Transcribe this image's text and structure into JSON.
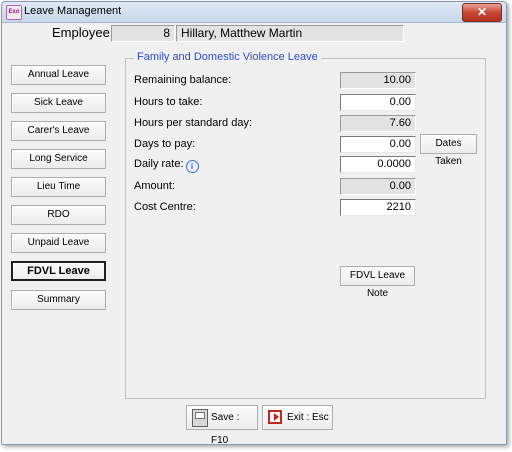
{
  "window": {
    "title": "Leave Management",
    "icon": "app-logo-icon",
    "close_label": "✕"
  },
  "employee": {
    "label": "Employee:",
    "number": "8",
    "name": "Hillary, Matthew  Martin"
  },
  "sidebar": {
    "items": [
      {
        "label": "Annual Leave",
        "active": false
      },
      {
        "label": "Sick Leave",
        "active": false
      },
      {
        "label": "Carer's Leave",
        "active": false
      },
      {
        "label": "Long Service",
        "active": false
      },
      {
        "label": "Lieu Time",
        "active": false
      },
      {
        "label": "RDO",
        "active": false
      },
      {
        "label": "Unpaid Leave",
        "active": false
      },
      {
        "label": "FDVL Leave",
        "active": true
      },
      {
        "label": "Summary",
        "active": false
      }
    ]
  },
  "group": {
    "title": "Family and Domestic Violence Leave",
    "fields": {
      "remaining_balance": {
        "label": "Remaining balance:",
        "value": "10.00",
        "editable": false
      },
      "hours_to_take": {
        "label": "Hours to take:",
        "value": "0.00",
        "editable": true
      },
      "hours_per_day": {
        "label": "Hours per standard day:",
        "value": "7.60",
        "editable": false
      },
      "days_to_pay": {
        "label": "Days to pay:",
        "value": "0.00",
        "editable": true
      },
      "daily_rate": {
        "label": "Daily rate:",
        "value": "0.0000",
        "editable": true
      },
      "amount": {
        "label": "Amount:",
        "value": "0.00",
        "editable": false
      },
      "cost_centre": {
        "label": "Cost Centre:",
        "value": "2210",
        "editable": true
      }
    },
    "dates_taken_label": "Dates Taken",
    "note_label": "FDVL Leave Note",
    "info_icon": "info-icon"
  },
  "footer": {
    "save_label": "Save : F10",
    "exit_label": "Exit : Esc"
  },
  "colors": {
    "group_title": "#2a4fd0",
    "close_button": "#c74634"
  }
}
